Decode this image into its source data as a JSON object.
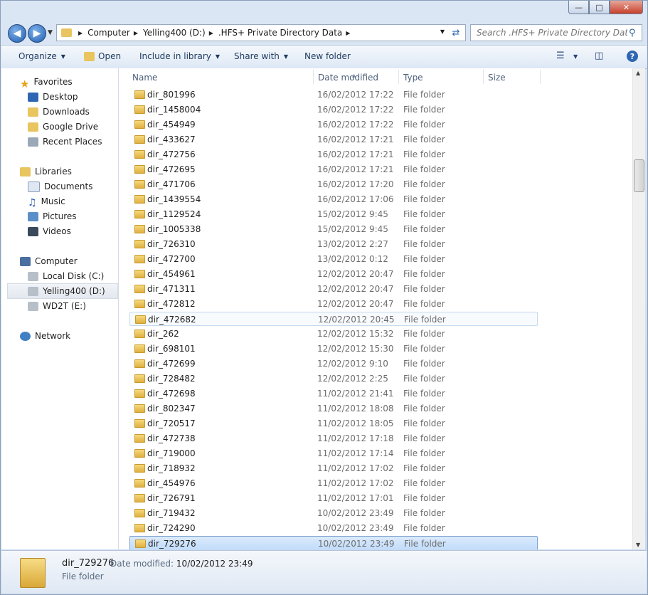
{
  "window": {
    "buttons": {
      "minimize": "—",
      "maximize": "□",
      "close": "✕"
    }
  },
  "address": {
    "crumbs": [
      "Computer",
      "Yelling400 (D:)",
      ".HFS+ Private Directory Data"
    ]
  },
  "search": {
    "placeholder": "Search .HFS+ Private Directory Data"
  },
  "toolbar": {
    "organize": "Organize",
    "open": "Open",
    "include": "Include in library",
    "share": "Share with",
    "newfolder": "New folder",
    "help": "?"
  },
  "nav": {
    "favorites": "Favorites",
    "desktop": "Desktop",
    "downloads": "Downloads",
    "google_drive": "Google Drive",
    "recent": "Recent Places",
    "libraries": "Libraries",
    "documents": "Documents",
    "music": "Music",
    "pictures": "Pictures",
    "videos": "Videos",
    "computer": "Computer",
    "local_disk": "Local Disk (C:)",
    "yelling": "Yelling400 (D:)",
    "wd2t": "WD2T (E:)",
    "network": "Network"
  },
  "columns": {
    "name": "Name",
    "date": "Date modified",
    "type": "Type",
    "size": "Size"
  },
  "files": [
    {
      "name": "dir_801996",
      "date": "16/02/2012 17:22",
      "type": "File folder"
    },
    {
      "name": "dir_1458004",
      "date": "16/02/2012 17:22",
      "type": "File folder"
    },
    {
      "name": "dir_454949",
      "date": "16/02/2012 17:22",
      "type": "File folder"
    },
    {
      "name": "dir_433627",
      "date": "16/02/2012 17:21",
      "type": "File folder"
    },
    {
      "name": "dir_472756",
      "date": "16/02/2012 17:21",
      "type": "File folder"
    },
    {
      "name": "dir_472695",
      "date": "16/02/2012 17:21",
      "type": "File folder"
    },
    {
      "name": "dir_471706",
      "date": "16/02/2012 17:20",
      "type": "File folder"
    },
    {
      "name": "dir_1439554",
      "date": "16/02/2012 17:06",
      "type": "File folder"
    },
    {
      "name": "dir_1129524",
      "date": "15/02/2012 9:45",
      "type": "File folder"
    },
    {
      "name": "dir_1005338",
      "date": "15/02/2012 9:45",
      "type": "File folder"
    },
    {
      "name": "dir_726310",
      "date": "13/02/2012 2:27",
      "type": "File folder"
    },
    {
      "name": "dir_472700",
      "date": "13/02/2012 0:12",
      "type": "File folder"
    },
    {
      "name": "dir_454961",
      "date": "12/02/2012 20:47",
      "type": "File folder"
    },
    {
      "name": "dir_471311",
      "date": "12/02/2012 20:47",
      "type": "File folder"
    },
    {
      "name": "dir_472812",
      "date": "12/02/2012 20:47",
      "type": "File folder"
    },
    {
      "name": "dir_472682",
      "date": "12/02/2012 20:45",
      "type": "File folder"
    },
    {
      "name": "dir_262",
      "date": "12/02/2012 15:32",
      "type": "File folder"
    },
    {
      "name": "dir_698101",
      "date": "12/02/2012 15:30",
      "type": "File folder"
    },
    {
      "name": "dir_472699",
      "date": "12/02/2012 9:10",
      "type": "File folder"
    },
    {
      "name": "dir_728482",
      "date": "12/02/2012 2:25",
      "type": "File folder"
    },
    {
      "name": "dir_472698",
      "date": "11/02/2012 21:41",
      "type": "File folder"
    },
    {
      "name": "dir_802347",
      "date": "11/02/2012 18:08",
      "type": "File folder"
    },
    {
      "name": "dir_720517",
      "date": "11/02/2012 18:05",
      "type": "File folder"
    },
    {
      "name": "dir_472738",
      "date": "11/02/2012 17:18",
      "type": "File folder"
    },
    {
      "name": "dir_719000",
      "date": "11/02/2012 17:14",
      "type": "File folder"
    },
    {
      "name": "dir_718932",
      "date": "11/02/2012 17:02",
      "type": "File folder"
    },
    {
      "name": "dir_454976",
      "date": "11/02/2012 17:02",
      "type": "File folder"
    },
    {
      "name": "dir_726791",
      "date": "11/02/2012 17:01",
      "type": "File folder"
    },
    {
      "name": "dir_719432",
      "date": "10/02/2012 23:49",
      "type": "File folder"
    },
    {
      "name": "dir_724290",
      "date": "10/02/2012 23:49",
      "type": "File folder"
    },
    {
      "name": "dir_729276",
      "date": "10/02/2012 23:49",
      "type": "File folder"
    }
  ],
  "details": {
    "name": "dir_729276",
    "modified_label": "Date modified:",
    "modified_value": "10/02/2012 23:49",
    "type": "File folder"
  }
}
